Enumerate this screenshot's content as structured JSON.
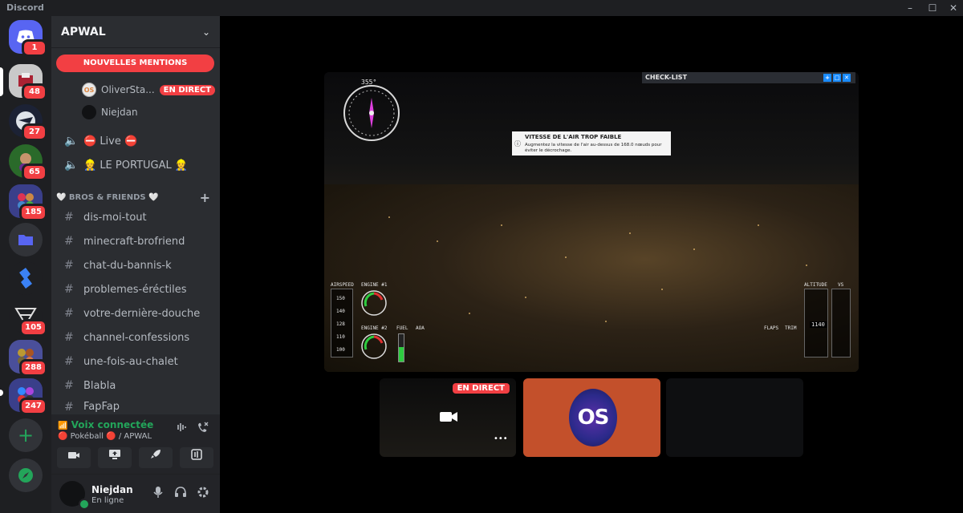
{
  "window": {
    "title": "Discord",
    "controls": [
      "–",
      "☐",
      "✕"
    ]
  },
  "rail": {
    "home_badge": "1",
    "servers": [
      {
        "badge": "48"
      },
      {
        "badge": "27"
      },
      {
        "badge": "65"
      },
      {
        "badge": "185"
      },
      {
        "badge": ""
      },
      {
        "badge": ""
      },
      {
        "badge": "105"
      },
      {
        "badge": "288"
      },
      {
        "badge": "247"
      }
    ],
    "add_label": "+",
    "explore_label": "🧭"
  },
  "guild": {
    "name": "APWAL",
    "mentions_banner": "NOUVELLES MENTIONS",
    "voice_users": [
      {
        "name": "OliverSta...",
        "initials": "OS",
        "live": "EN DIRECT"
      },
      {
        "name": "Niejdan",
        "initials": "",
        "live": ""
      }
    ],
    "voice_channels": [
      {
        "label": "⛔ Live ⛔"
      },
      {
        "label": "👷 LE PORTUGAL 👷"
      }
    ],
    "category": "🤍 BROS & FRIENDS 🤍",
    "text_channels": [
      "dis-moi-tout",
      "minecraft-brofriend",
      "chat-du-bannis-k",
      "problemes-éréctiles",
      "votre-dernière-douche",
      "channel-confessions",
      "une-fois-au-chalet",
      "Blabla",
      "FapFap"
    ]
  },
  "voice_panel": {
    "status": "Voix connectée",
    "channel": "🔴 Pokéball 🔴 / APWAL"
  },
  "user": {
    "name": "Niejdan",
    "status": "En ligne"
  },
  "stream": {
    "checklist_title": "CHECK-LIST",
    "alert_title": "VITESSE DE L'AIR TROP FAIBLE",
    "alert_body": "Augmentez la vitesse de l'air au-dessus de 168.0 nœuds pour éviter le décrochage.",
    "heading": "355°",
    "labels": {
      "airspeed": "AIRSPEED",
      "engine1": "ENGINE #1",
      "engine2": "ENGINE #2",
      "fuel": "FUEL",
      "aoa": "AOA",
      "flaps": "FLAPS",
      "trim": "TRIM",
      "altitude": "ALTITUDE",
      "vs": "VS",
      "alt_value": "1140",
      "speed_values": [
        "150",
        "140",
        "128",
        "110",
        "100"
      ]
    }
  },
  "tiles": {
    "live_label": "EN DIRECT",
    "os_label": "OS",
    "more": "•••"
  }
}
